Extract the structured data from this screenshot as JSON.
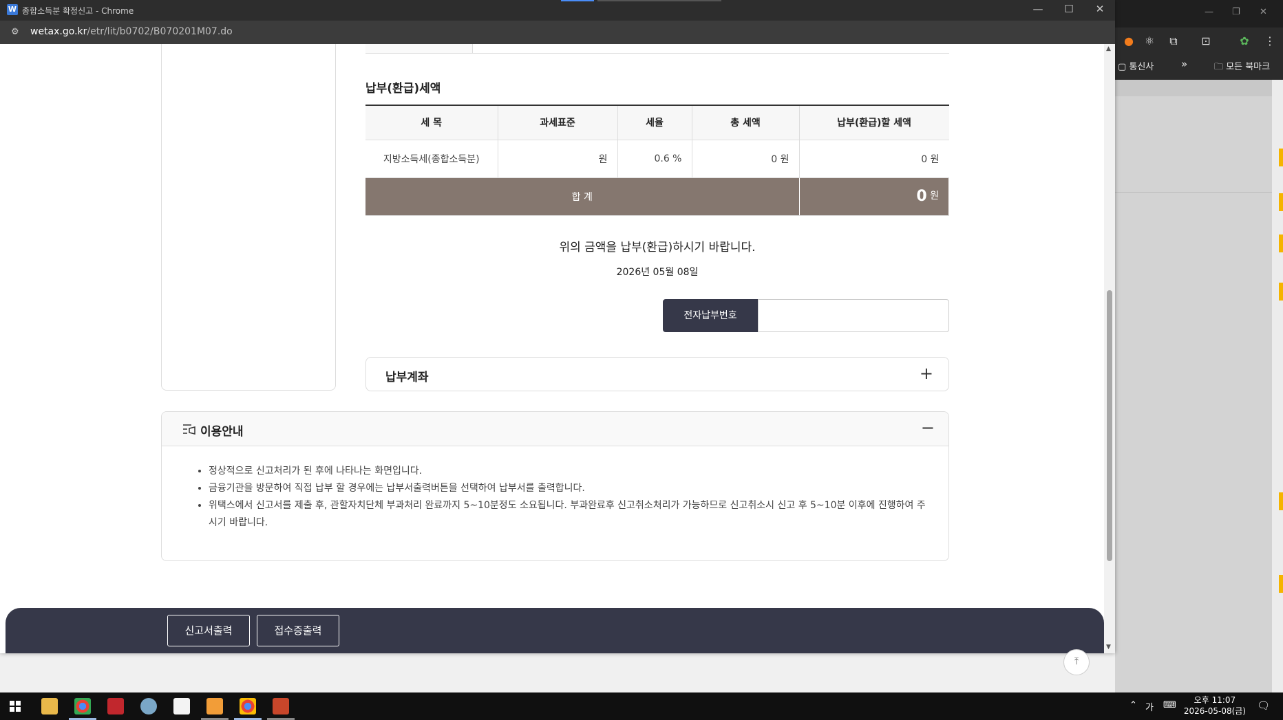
{
  "browser": {
    "window_title": "종합소득분 확정신고 - Chrome",
    "favicon_letter": "W",
    "url_domain": "wetax.go.kr",
    "url_path": "/etr/lit/b0702/B070201M07.do"
  },
  "background_browser": {
    "bookmark_left": "통신사",
    "bookmark_more": "»",
    "bookmark_folder": "모든 북마크"
  },
  "section": {
    "title": "납부(환급)세액"
  },
  "tax_table": {
    "headers": [
      "세 목",
      "과세표준",
      "세율",
      "총 세액",
      "납부(환급)할 세액"
    ],
    "rows": [
      {
        "item": "지방소득세(종합소득분)",
        "base": "원",
        "rate": "0.6 %",
        "total": "0 원",
        "payable": "0 원"
      }
    ],
    "total_label": "합 계",
    "total_value": "0",
    "total_unit": "원"
  },
  "notice": {
    "message": "위의 금액을 납부(환급)하시기 바랍니다.",
    "date": "2026년 05월 08일"
  },
  "epay": {
    "label": "전자납부번호",
    "value": ""
  },
  "account": {
    "title": "납부계좌",
    "toggle": "+"
  },
  "guide": {
    "title": "이용안내",
    "toggle": "−",
    "items": [
      "정상적으로 신고처리가 된 후에 나타나는 화면입니다.",
      "금융기관을 방문하여 직접 납부 할 경우에는 납부서출력버튼을 선택하여 납부서를 출력합니다.",
      "위택스에서 신고서를 제출 후, 관할자치단체 부과처리 완료까지 5~10분정도 소요됩니다. 부과완료후 신고취소처리가 가능하므로 신고취소시 신고 후 5~10분 이후에 진행하여 주시기 바랍니다."
    ]
  },
  "bottom_bar": {
    "print_report": "신고서출력",
    "print_receipt": "접수증출력"
  },
  "taskbar": {
    "ime": "가",
    "time": "오후 11:07",
    "date": "2026-05-08(금)"
  }
}
